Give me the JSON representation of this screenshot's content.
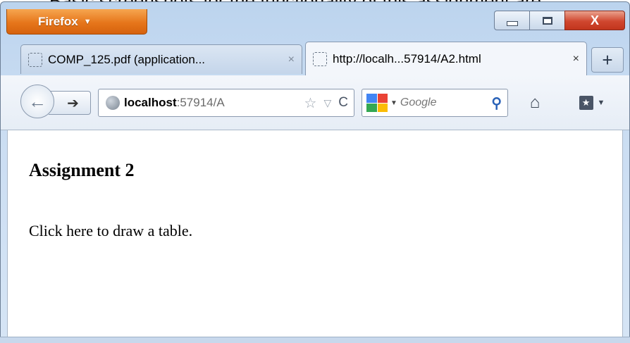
{
  "caption": {
    "text": "Basic screenshots for the functionality of this assignment are"
  },
  "titlebar": {
    "app_menu_label": "Firefox",
    "app_menu_arrow": "▼",
    "close_glyph": "X"
  },
  "tabs": [
    {
      "label": "COMP_125.pdf (application...",
      "close": "×",
      "active": false
    },
    {
      "label": "http://localh...57914/A2.html",
      "close": "×",
      "active": true
    }
  ],
  "new_tab_label": "+",
  "navbar": {
    "back_glyph": "←",
    "forward_glyph": "➔",
    "url_host": "localhost",
    "url_rest": ":57914/A",
    "bookmark_star": "☆",
    "history_arrow": "▽",
    "reload_glyph": "C",
    "search_placeholder": "Google",
    "search_arrow": "▼",
    "search_glyph": "⚲",
    "home_glyph": "⌂",
    "bookmarks_glyph": "★",
    "bookmarks_arrow": "▼"
  },
  "page": {
    "heading": "Assignment 2",
    "link_text": "Click here to draw a table."
  }
}
